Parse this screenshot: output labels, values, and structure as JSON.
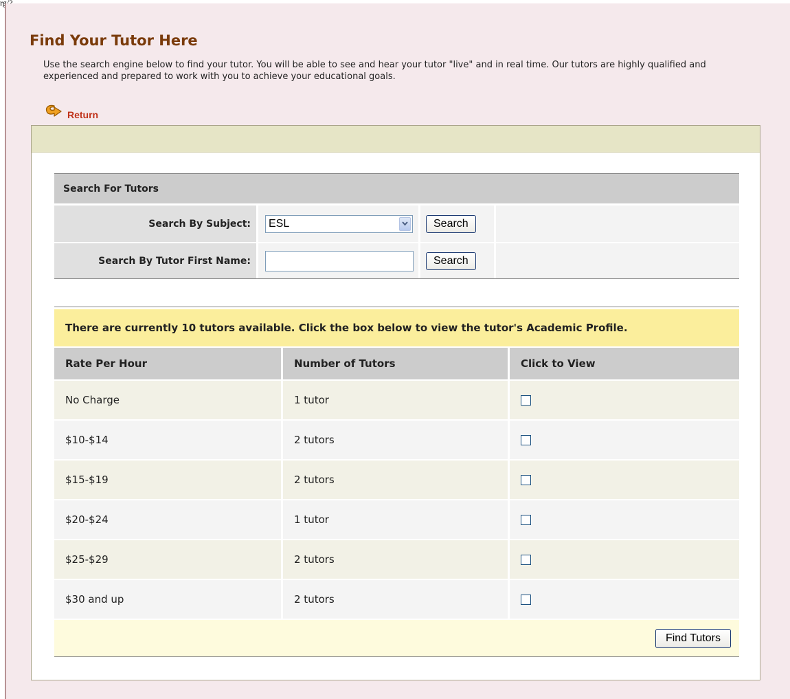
{
  "top_text": "rg/?",
  "page": {
    "title": "Find Your Tutor Here",
    "intro": "Use the search engine below to find your tutor. You will be able to see and hear your tutor \"live\" and in real time. Our tutors are highly qualified and experienced and prepared to work with you to achieve your educational goals.",
    "return_label": "Return"
  },
  "search": {
    "header": "Search For Tutors",
    "subject_label": "Search By Subject:",
    "subject_value": "ESL",
    "name_label": "Search By Tutor First Name:",
    "name_value": "",
    "search_button": "Search"
  },
  "tutors": {
    "notice": "There are currently 10 tutors available. Click the box below to view the tutor's Academic Profile.",
    "columns": [
      "Rate Per Hour",
      "Number of Tutors",
      "Click to View"
    ],
    "rows": [
      {
        "rate": "No Charge",
        "count": "1 tutor"
      },
      {
        "rate": "$10-$14",
        "count": "2 tutors"
      },
      {
        "rate": "$15-$19",
        "count": "2 tutors"
      },
      {
        "rate": "$20-$24",
        "count": "1 tutor"
      },
      {
        "rate": "$25-$29",
        "count": "2 tutors"
      },
      {
        "rate": "$30 and up",
        "count": "2 tutors"
      }
    ],
    "find_button": "Find Tutors"
  },
  "icons": {
    "return": "return-arrow-icon",
    "dropdown": "chevron-down-icon"
  },
  "colors": {
    "title": "#7a3b0a",
    "return_link": "#c0321a",
    "page_bg": "#f5e9ec",
    "band": "#e6e5c6",
    "notice_bg": "#fbee9c"
  }
}
